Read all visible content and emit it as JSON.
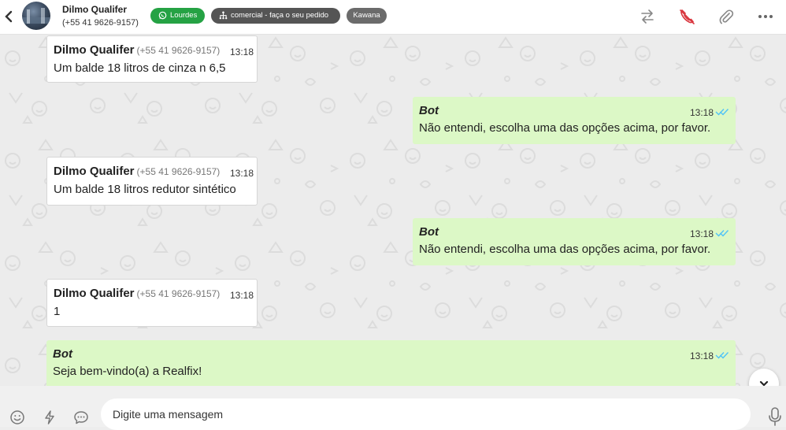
{
  "header": {
    "contact_name": "Dilmo Qualifer",
    "contact_phone": "(+55 41 9626-9157)",
    "tags": [
      {
        "label": "Lourdes",
        "color": "#25a244",
        "icon": "whatsapp-icon"
      },
      {
        "label": "comercial - faça o seu pedido",
        "color": "#555555",
        "icon": "sitemap-icon"
      },
      {
        "label": "Kawana",
        "color": "#6b6b6b"
      }
    ],
    "actions": [
      "transfer-icon",
      "end-call-icon",
      "paperclip-icon",
      "more-icon"
    ]
  },
  "messages": [
    {
      "direction": "in",
      "sender": "Dilmo Qualifer",
      "phone": "(+55 41 9626-9157)",
      "time": "13:18",
      "text": "Um balde 18 litros de cinza n 6,5"
    },
    {
      "direction": "out",
      "sender": "Bot",
      "time": "13:18",
      "text": "Não entendi, escolha uma das opções acima, por favor."
    },
    {
      "direction": "in",
      "sender": "Dilmo Qualifer",
      "phone": "(+55 41 9626-9157)",
      "time": "13:18",
      "text": "Um balde 18 litros redutor sintético"
    },
    {
      "direction": "out",
      "sender": "Bot",
      "time": "13:18",
      "text": "Não entendi, escolha uma das opções acima, por favor."
    },
    {
      "direction": "in",
      "sender": "Dilmo Qualifer",
      "phone": "(+55 41 9626-9157)",
      "time": "13:18",
      "text": "1"
    },
    {
      "direction": "out",
      "sender": "Bot",
      "time": "13:18",
      "text": "Seja bem-vindo(a) a Realfix!"
    }
  ],
  "composer": {
    "placeholder": "Digite uma mensagem"
  },
  "colors": {
    "incoming_bubble": "#ffffff",
    "outgoing_bubble": "#dcf8c6",
    "read_ticks": "#4fc3f7",
    "chat_background": "#ececec"
  }
}
